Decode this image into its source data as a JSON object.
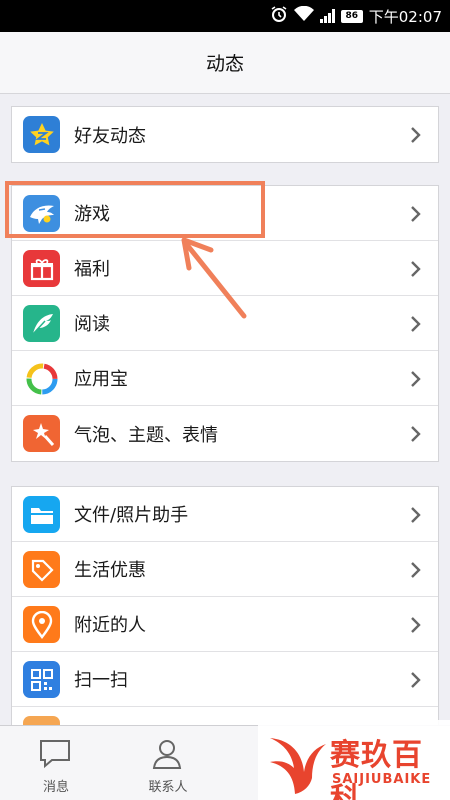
{
  "status_bar": {
    "time": "下午02:07",
    "battery": "86",
    "icons": [
      "alarm-icon",
      "wifi-icon",
      "signal-icon",
      "battery-icon"
    ]
  },
  "header": {
    "title": "动态"
  },
  "groups": [
    {
      "items": [
        {
          "label": "好友动态",
          "icon": "qzone-star-icon",
          "color": "#2e7fd6"
        }
      ]
    },
    {
      "items": [
        {
          "label": "游戏",
          "icon": "game-shark-icon",
          "color": "#3d8fe0"
        },
        {
          "label": "福利",
          "icon": "gift-icon",
          "color": "#e8383a"
        },
        {
          "label": "阅读",
          "icon": "feather-icon",
          "color": "#26b58b"
        },
        {
          "label": "应用宝",
          "icon": "app-store-icon",
          "color": "#ffffff"
        },
        {
          "label": "气泡、主题、表情",
          "icon": "magic-wand-icon",
          "color": "#f06533"
        }
      ]
    },
    {
      "items": [
        {
          "label": "文件/照片助手",
          "icon": "folder-icon",
          "color": "#16a7f0"
        },
        {
          "label": "生活优惠",
          "icon": "price-tag-icon",
          "color": "#ff7a1a"
        },
        {
          "label": "附近的人",
          "icon": "location-pin-icon",
          "color": "#ff7a1a"
        },
        {
          "label": "扫一扫",
          "icon": "qr-code-icon",
          "color": "#2f7fe0"
        }
      ]
    }
  ],
  "tabs": [
    {
      "label": "消息",
      "icon": "chat-bubble-icon"
    },
    {
      "label": "联系人",
      "icon": "contact-person-icon"
    }
  ],
  "annotation": {
    "highlight_color": "#f0805a"
  },
  "watermark": {
    "cn": "赛玖百科",
    "en": "SAIJIUBAIKE",
    "color": "#e8442e"
  }
}
